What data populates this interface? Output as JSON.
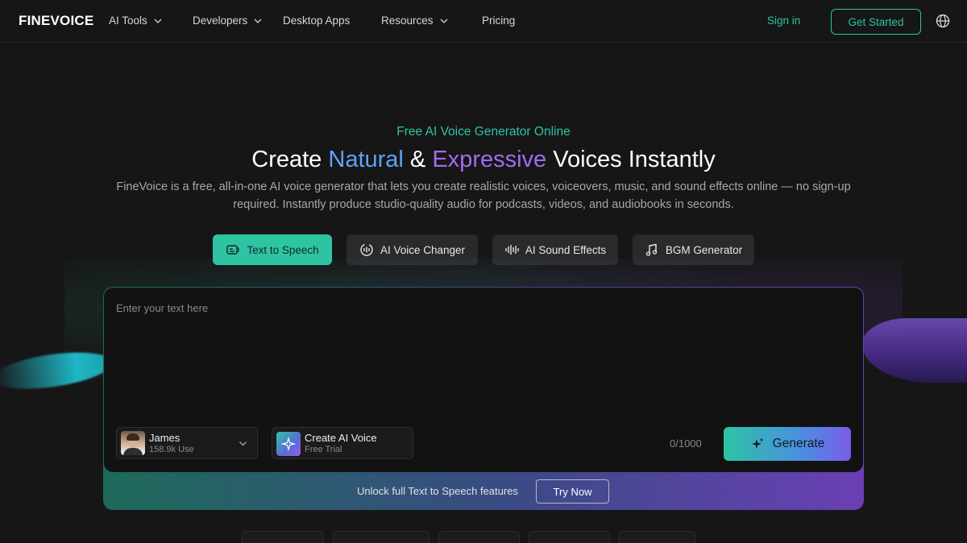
{
  "nav": {
    "logo": "FINEVOICE",
    "items": [
      {
        "label": "AI Tools",
        "dropdown": true
      },
      {
        "label": "Developers",
        "dropdown": true
      },
      {
        "label": "Desktop Apps",
        "dropdown": false
      },
      {
        "label": "Resources",
        "dropdown": true
      },
      {
        "label": "Pricing",
        "dropdown": false
      }
    ],
    "sign_in": "Sign in",
    "get_started": "Get Started",
    "language_icon": "globe-icon"
  },
  "hero": {
    "eyebrow": "Free AI Voice Generator Online",
    "headline_prefix": "Create ",
    "headline_natural": "Natural",
    "headline_amp": " & ",
    "headline_expressive": "Expressive",
    "headline_suffix": " Voices Instantly",
    "subtext": "FineVoice is a free, all-in-one AI voice generator that lets you create realistic voices, voiceovers, music, and sound effects online — no sign-up required. Instantly produce studio-quality audio for podcasts, videos, and audiobooks in seconds."
  },
  "tabs": [
    {
      "label": "Text to Speech",
      "icon": "text-to-speech-icon",
      "active": true
    },
    {
      "label": "AI Voice Changer",
      "icon": "voice-changer-icon",
      "active": false
    },
    {
      "label": "AI Sound Effects",
      "icon": "sound-wave-icon",
      "active": false
    },
    {
      "label": "BGM Generator",
      "icon": "music-note-icon",
      "active": false
    }
  ],
  "editor": {
    "placeholder": "Enter your text here",
    "voice": {
      "name": "James",
      "usage": "158.9k Use"
    },
    "create_voice": {
      "title": "Create AI Voice",
      "subtitle": "Free Trial"
    },
    "char_count": "0/1000",
    "generate_label": "Generate"
  },
  "unlock": {
    "text": "Unlock full Text to Speech features",
    "button": "Try Now"
  },
  "colors": {
    "accent_teal": "#2ec4a3",
    "accent_blue": "#5ba4f5",
    "accent_purple": "#a36bf2",
    "background": "#161616"
  }
}
